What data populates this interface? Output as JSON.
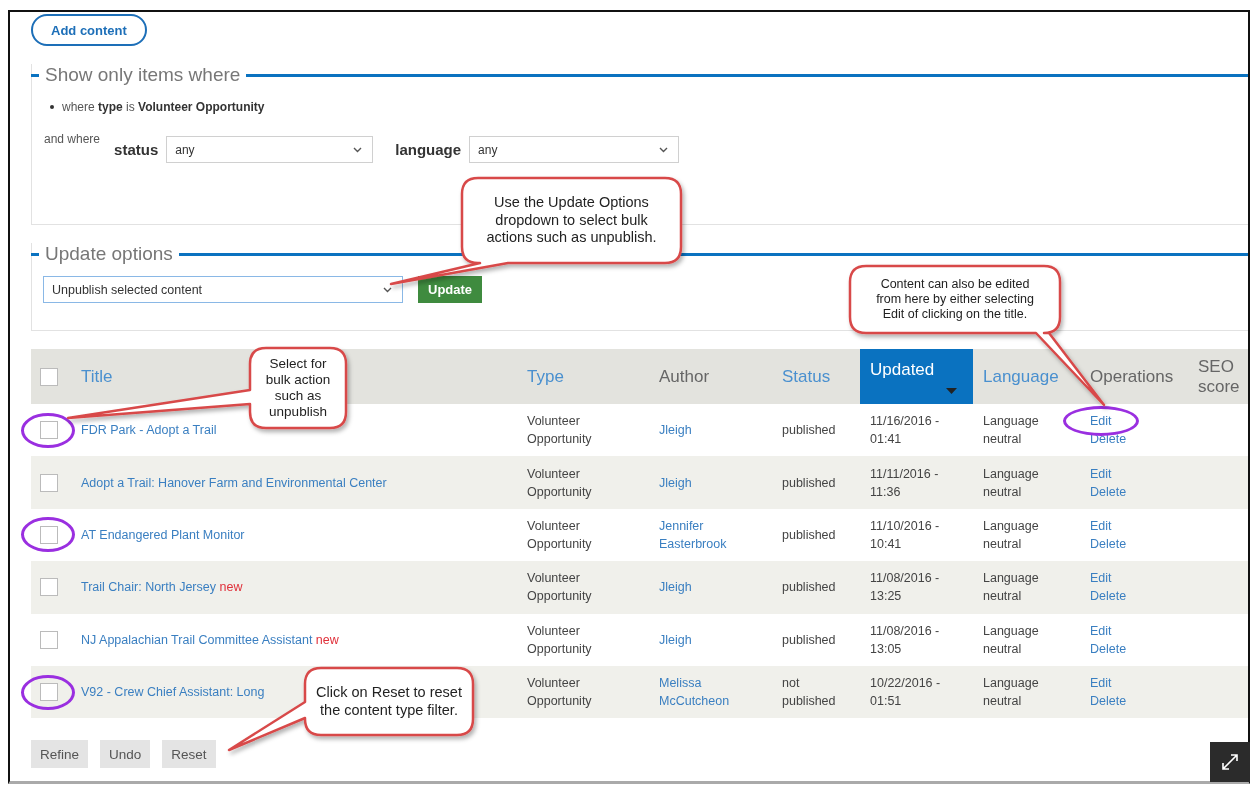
{
  "add_button": "Add content",
  "filter": {
    "legend": "Show only items where",
    "condition": "where **type** is **Volunteer Opportunity**",
    "and_where": "and where",
    "fields": [
      {
        "label": "status",
        "value": "any"
      },
      {
        "label": "language",
        "value": "any"
      }
    ]
  },
  "update_options": {
    "legend": "Update options",
    "value": "Unpublish selected content",
    "button": "Update"
  },
  "table": {
    "select_all": {
      "checked": false
    },
    "columns": [
      {
        "label": "Title",
        "sortable": true,
        "selected": false
      },
      {
        "label": "Type",
        "sortable": true,
        "selected": false
      },
      {
        "label": "Author",
        "sortable": false,
        "selected": false
      },
      {
        "label": "Status",
        "sortable": true,
        "selected": false
      },
      {
        "label": "Updated",
        "sortable": true,
        "selected": true
      },
      {
        "label": "Language",
        "sortable": true,
        "selected": false
      },
      {
        "label": "Operations",
        "sortable": false,
        "selected": false
      },
      {
        "label": "SEO score",
        "sortable": false,
        "selected": false
      }
    ],
    "rows": [
      {
        "checked": false,
        "checkbox_circled": true,
        "title": "FDR Park - Adopt a Trail",
        "type": "Volunteer Opportunity",
        "author": "Jleigh",
        "status": "published",
        "updated": "11/16/2016 - 01:41",
        "language": "Language neutral",
        "edit": "Edit",
        "delete": "Delete",
        "edit_circled": true
      },
      {
        "checked": false,
        "checkbox_circled": false,
        "title": "Adopt a Trail: Hanover Farm and Environmental Center",
        "type": "Volunteer Opportunity",
        "author": "Jleigh",
        "status": "published",
        "updated": "11/11/2016 - 11:36",
        "language": "Language neutral",
        "edit": "Edit",
        "delete": "Delete",
        "edit_circled": false
      },
      {
        "checked": false,
        "checkbox_circled": true,
        "title": "AT Endangered Plant Monitor",
        "type": "Volunteer Opportunity",
        "author": "Jennifer Easterbrook",
        "status": "published",
        "updated": "11/10/2016 - 10:41",
        "language": "Language neutral",
        "edit": "Edit",
        "delete": "Delete",
        "edit_circled": false
      },
      {
        "checked": false,
        "checkbox_circled": false,
        "title": "Trail Chair: North Jersey",
        "marker": "new",
        "type": "Volunteer Opportunity",
        "author": "Jleigh",
        "status": "published",
        "updated": "11/08/2016 - 13:25",
        "language": "Language neutral",
        "edit": "Edit",
        "delete": "Delete",
        "edit_circled": false
      },
      {
        "checked": false,
        "checkbox_circled": false,
        "title": "NJ Appalachian Trail Committee Assistant",
        "marker": "new",
        "type": "Volunteer Opportunity",
        "author": "Jleigh",
        "status": "published",
        "updated": "11/08/2016 - 13:05",
        "language": "Language neutral",
        "edit": "Edit",
        "delete": "Delete",
        "edit_circled": false
      },
      {
        "checked": false,
        "checkbox_circled": true,
        "title": "V92 - Crew Chief Assistant: Long",
        "type": "Volunteer Opportunity",
        "author": "Melissa McCutcheon",
        "status": "not published",
        "updated": "10/22/2016 - 01:51",
        "language": "Language neutral",
        "edit": "Edit",
        "delete": "Delete",
        "edit_circled": false
      }
    ]
  },
  "footer_buttons": [
    "Refine",
    "Undo",
    "Reset"
  ],
  "callouts": [
    {
      "text": "Use the Update Options dropdown to select bulk actions such as unpublish."
    },
    {
      "text": "Content can also be edited from here by either selecting Edit of clicking on the title."
    },
    {
      "text": "Select for bulk action such as unpublish"
    },
    {
      "text": "Click on Reset to reset the content type filter."
    }
  ]
}
